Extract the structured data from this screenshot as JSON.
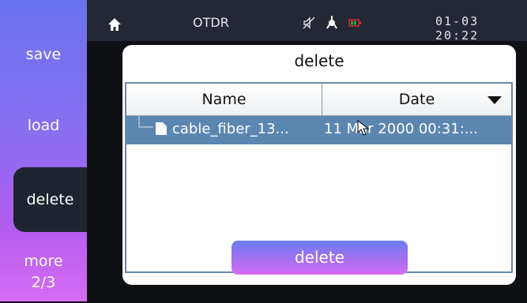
{
  "sidebar": {
    "save": "save",
    "load": "load",
    "delete": "delete",
    "more": "more",
    "page": "2/3"
  },
  "statusbar": {
    "title": "OTDR",
    "clock": "01-03 20:22",
    "icons": [
      "home-icon",
      "mute-icon",
      "probe-icon",
      "battery-icon"
    ]
  },
  "dialog": {
    "title": "delete",
    "columns": [
      "Name",
      "Date"
    ],
    "rows": [
      {
        "name": "cable_fiber_13...",
        "date": "11 Mar 2000 00:31:..."
      }
    ],
    "button": "delete"
  }
}
